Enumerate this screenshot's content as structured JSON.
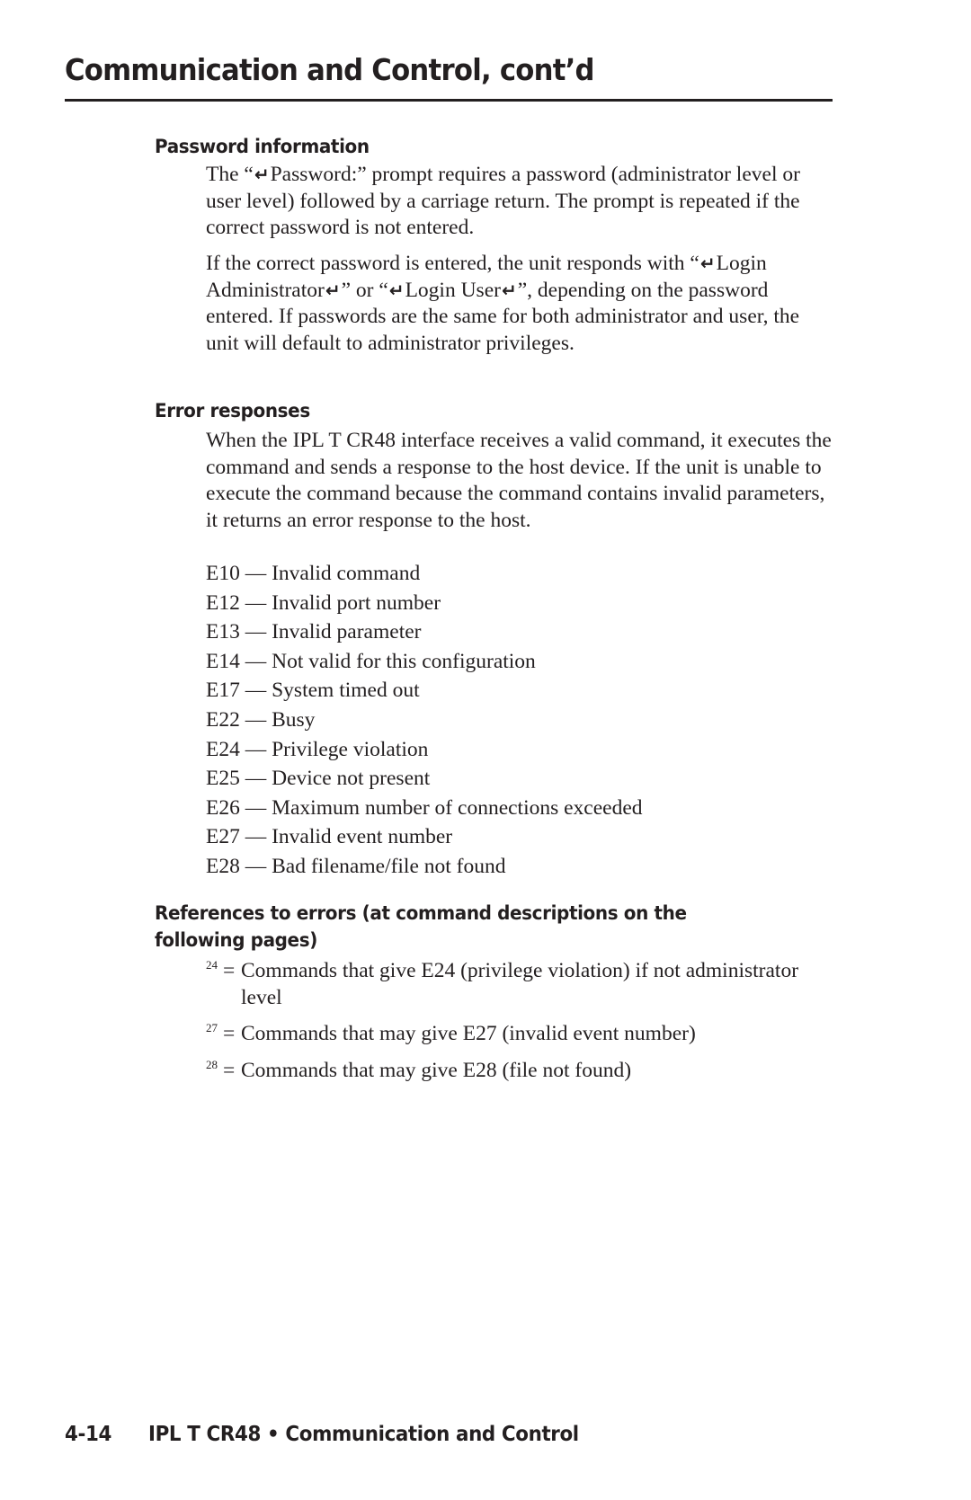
{
  "header": {
    "title": "Communication and Control, cont’d"
  },
  "password_section": {
    "heading": "Password information",
    "para1": {
      "before": "The “",
      "icon": "carriage-return-icon",
      "after": "Password:” prompt requires a password (administrator level or user level) followed by a carriage return.  The prompt is repeated if the correct password is not entered."
    },
    "para2": {
      "part1": "If the correct password is entered, the unit responds with “",
      "part2": "Login Administrator",
      "part3": "” or “",
      "part4": "Login User",
      "part5": "”, depending on the password entered.  If passwords are the same for both administrator and user, the unit will default to administrator privileges."
    }
  },
  "error_section": {
    "heading": "Error responses",
    "intro": "When the IPL T CR48 interface receives a valid command, it executes the command and sends a response to the host device.  If the unit is unable to execute the command because the command contains invalid parameters, it returns an error response to the host.",
    "errors": [
      {
        "code": "E10",
        "separator": " — ",
        "description": "Invalid command"
      },
      {
        "code": "E12",
        "separator": " — ",
        "description": "Invalid port number"
      },
      {
        "code": "E13",
        "separator": " — ",
        "description": "Invalid parameter"
      },
      {
        "code": "E14",
        "separator": " — ",
        "description": "Not valid for this configuration"
      },
      {
        "code": "E17",
        "separator": " — ",
        "description": "System timed out"
      },
      {
        "code": "E22",
        "separator": " — ",
        "description": "Busy"
      },
      {
        "code": "E24",
        "separator": " — ",
        "description": "Privilege violation"
      },
      {
        "code": "E25",
        "separator": " — ",
        "description": "Device not present"
      },
      {
        "code": "E26",
        "separator": " — ",
        "description": "Maximum number of connections exceeded"
      },
      {
        "code": "E27",
        "separator": " — ",
        "description": "Invalid event number"
      },
      {
        "code": "E28",
        "separator": " — ",
        "description": "Bad filename/file not found"
      }
    ]
  },
  "references_section": {
    "heading_line1": "References to errors (at command descriptions on the",
    "heading_line2": "following pages)",
    "items": [
      {
        "sup": "24",
        "eq": "=",
        "text": "Commands that give E24 (privilege violation) if not administrator level"
      },
      {
        "sup": "27",
        "eq": "=",
        "text": "Commands that may give E27 (invalid event number)"
      },
      {
        "sup": "28",
        "eq": "=",
        "text": "Commands that may give E28 (file not found)"
      }
    ]
  },
  "footer": {
    "page_number": "4-14",
    "text": "IPL T CR48 • Communication and Control"
  },
  "icons": {
    "carriage_return_glyph": "↵"
  }
}
